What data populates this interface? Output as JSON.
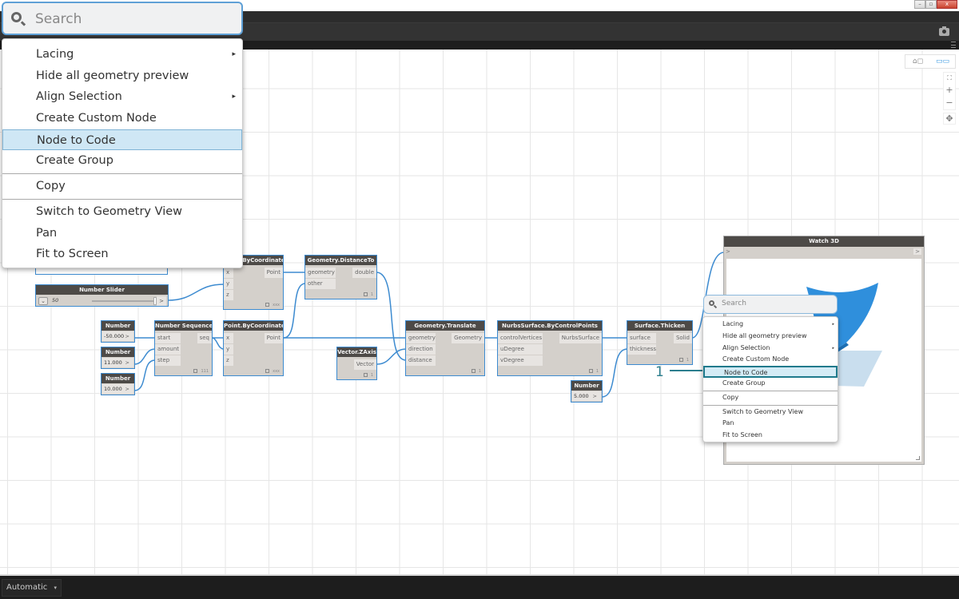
{
  "window": {
    "controls": {
      "minimize": "–",
      "restore": "▫",
      "close": "x"
    }
  },
  "toolbar": {
    "camera_icon": "camera-icon",
    "menu_icon": "hamburger-icon"
  },
  "view_toggle": {
    "geometry_view_icon": "⌂◻",
    "graph_view_icon": "▭▭"
  },
  "zoom_controls": {
    "fit": "⛶",
    "zoom_in": "+",
    "zoom_out": "−",
    "pan": "✥"
  },
  "bottom_bar": {
    "run_mode": "Automatic",
    "caret": "▾"
  },
  "nodes": {
    "number_slider": {
      "title": "Number Slider",
      "value": "50",
      "expand": "⌄",
      "out": ">"
    },
    "point_by_coords_top": {
      "title": "Point.ByCoordinates",
      "inputs": [
        "x",
        "y",
        "z"
      ],
      "output": "Point",
      "lacing": "xxx"
    },
    "distance_to": {
      "title": "Geometry.DistanceTo",
      "inputs": [
        "geometry",
        "other"
      ],
      "output": "double",
      "lacing": "1"
    },
    "number_a": {
      "title": "Number",
      "value": "-50.000",
      "out": ">"
    },
    "number_b": {
      "title": "Number",
      "value": "11.000",
      "out": ">"
    },
    "number_c": {
      "title": "Number",
      "value": "10.000",
      "out": ">"
    },
    "number_sequence": {
      "title": "Number Sequence",
      "inputs": [
        "start",
        "amount",
        "step"
      ],
      "output": "seq",
      "lacing": "111"
    },
    "point_by_coords": {
      "title": "Point.ByCoordinates",
      "inputs": [
        "x",
        "y",
        "z"
      ],
      "output": "Point",
      "lacing": "xxx"
    },
    "vector_zaxis": {
      "title": "Vector.ZAxis",
      "output": "Vector",
      "lacing": "1"
    },
    "geometry_translate": {
      "title": "Geometry.Translate",
      "inputs": [
        "geometry",
        "direction",
        "distance"
      ],
      "output": "Geometry",
      "lacing": "1"
    },
    "nurbs_surface": {
      "title": "NurbsSurface.ByControlPoints",
      "inputs": [
        "controlVertices",
        "uDegree",
        "vDegree"
      ],
      "output": "NurbsSurface",
      "lacing": "1"
    },
    "surface_thicken": {
      "title": "Surface.Thicken",
      "inputs": [
        "surface",
        "thickness"
      ],
      "output": "Solid",
      "lacing": "1"
    },
    "number_d": {
      "title": "Number",
      "value": "5.000",
      "out": ">"
    },
    "watch3d": {
      "title": "Watch 3D",
      "in": ">",
      "out": ">"
    }
  },
  "context_menu_large": {
    "search_placeholder": "Search",
    "items": [
      {
        "label": "Lacing",
        "submenu": "▸"
      },
      {
        "label": "Hide all geometry preview"
      },
      {
        "label": "Align Selection",
        "submenu": "▸"
      },
      {
        "label": "Create Custom Node"
      },
      {
        "label": "Node to Code",
        "highlighted": true
      },
      {
        "label": "Create Group"
      },
      {
        "label": "Copy"
      },
      {
        "label": "Switch to Geometry View"
      },
      {
        "label": "Pan"
      },
      {
        "label": "Fit to Screen"
      }
    ]
  },
  "context_menu_small": {
    "search_placeholder": "Search",
    "items": [
      {
        "label": "Lacing",
        "submenu": "▸"
      },
      {
        "label": "Hide all geometry preview"
      },
      {
        "label": "Align Selection",
        "submenu": "▸"
      },
      {
        "label": "Create Custom Node"
      },
      {
        "label": "Node to Code",
        "highlighted": true
      },
      {
        "label": "Create Group"
      },
      {
        "label": "Copy"
      },
      {
        "label": "Switch to Geometry View"
      },
      {
        "label": "Pan"
      },
      {
        "label": "Fit to Screen"
      }
    ]
  },
  "callout": {
    "label": "1",
    "color": "#2b7e8e"
  },
  "colors": {
    "wire": "#3d8bd0",
    "node_header": "#4d4a47",
    "highlight": "#cfe7f5",
    "accent": "#3b9ae1"
  }
}
